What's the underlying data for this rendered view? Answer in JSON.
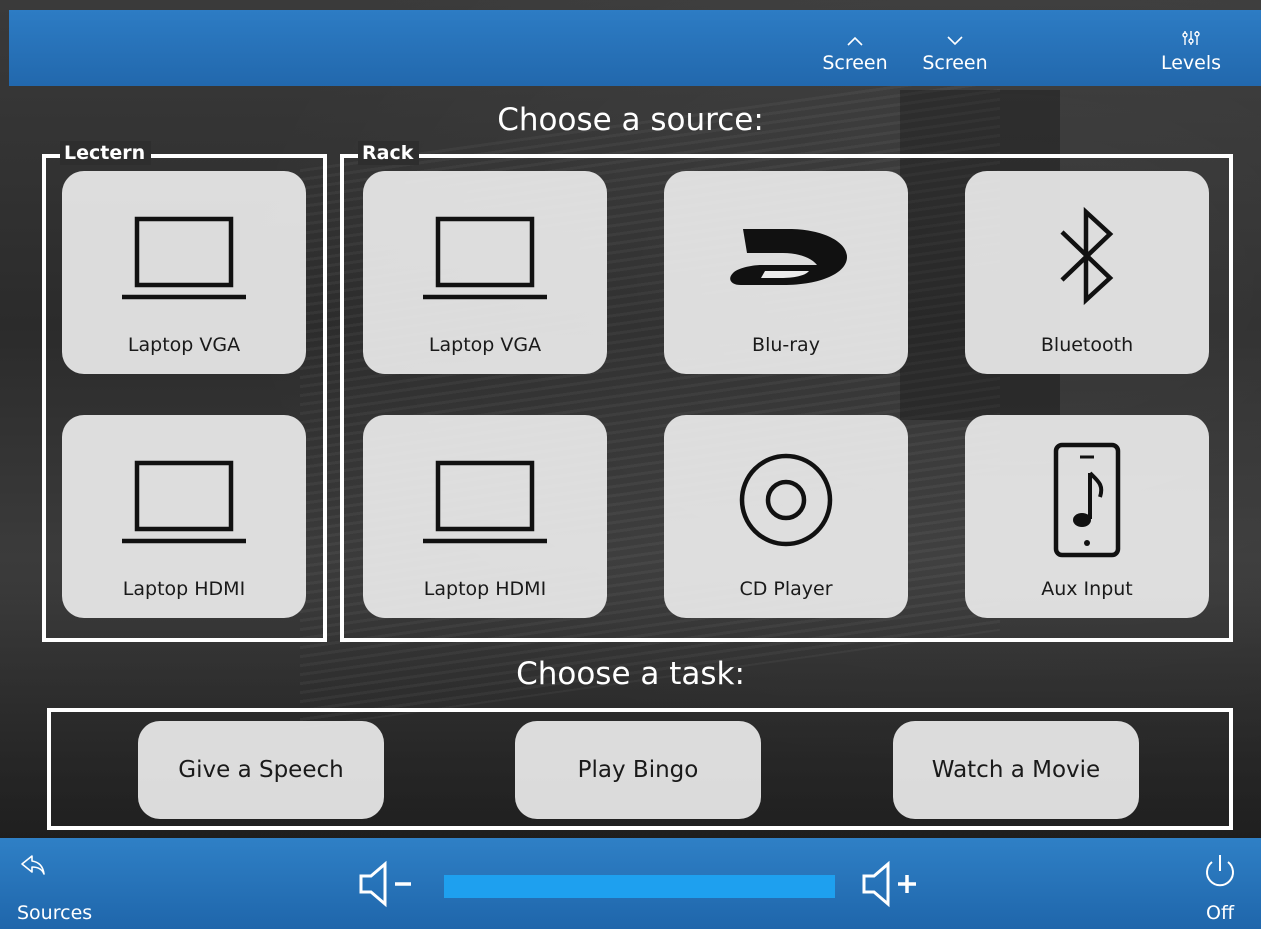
{
  "topbar": {
    "screen_up_label": "Screen",
    "screen_down_label": "Screen",
    "levels_label": "Levels"
  },
  "headings": {
    "source": "Choose a source:",
    "task": "Choose a task:"
  },
  "lectern": {
    "title": "Lectern",
    "items": [
      {
        "label": "Laptop VGA",
        "icon": "laptop-icon"
      },
      {
        "label": "Laptop HDMI",
        "icon": "laptop-icon"
      }
    ]
  },
  "rack": {
    "title": "Rack",
    "items": [
      {
        "label": "Laptop VGA",
        "icon": "laptop-icon"
      },
      {
        "label": "Blu-ray",
        "icon": "bluray-icon"
      },
      {
        "label": "Bluetooth",
        "icon": "bluetooth-icon"
      },
      {
        "label": "Laptop HDMI",
        "icon": "laptop-icon"
      },
      {
        "label": "CD Player",
        "icon": "disc-icon"
      },
      {
        "label": "Aux Input",
        "icon": "phone-music-icon"
      }
    ]
  },
  "tasks": [
    {
      "label": "Give a Speech"
    },
    {
      "label": "Play Bingo"
    },
    {
      "label": "Watch a Movie"
    }
  ],
  "bottombar": {
    "sources_label": "Sources",
    "off_label": "Off",
    "volume_level": 1.0
  },
  "colors": {
    "bar_blue": "#2670b8",
    "volume_fill": "#1ea0ef",
    "tile_bg": "#ececec"
  }
}
